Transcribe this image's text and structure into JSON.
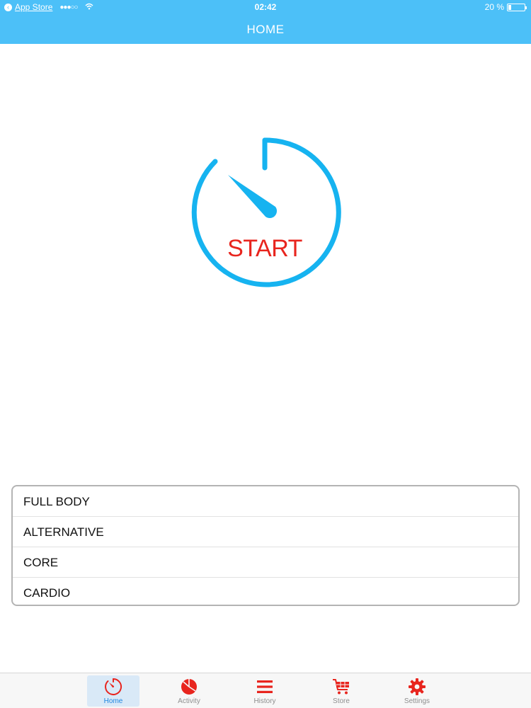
{
  "status_bar": {
    "back_app": "App Store",
    "signal": "●●●○○",
    "time": "02:42",
    "battery": "20 %",
    "battery_level": 0.2
  },
  "nav": {
    "title": "HOME"
  },
  "start_button": {
    "label": "START"
  },
  "workouts": [
    {
      "label": "FULL BODY"
    },
    {
      "label": "ALTERNATIVE"
    },
    {
      "label": "CORE"
    },
    {
      "label": "CARDIO"
    }
  ],
  "tabs": [
    {
      "label": "Home",
      "icon": "stopwatch-icon",
      "active": true
    },
    {
      "label": "Activity",
      "icon": "pie-chart-icon",
      "active": false
    },
    {
      "label": "History",
      "icon": "list-icon",
      "active": false
    },
    {
      "label": "Store",
      "icon": "cart-icon",
      "active": false
    },
    {
      "label": "Settings",
      "icon": "gear-icon",
      "active": false
    }
  ],
  "colors": {
    "header": "#4cc0f8",
    "timer_ring": "#16b3f0",
    "start_text": "#e8251e",
    "tab_icon": "#e8251e",
    "tab_active_label": "#1f86e0"
  }
}
